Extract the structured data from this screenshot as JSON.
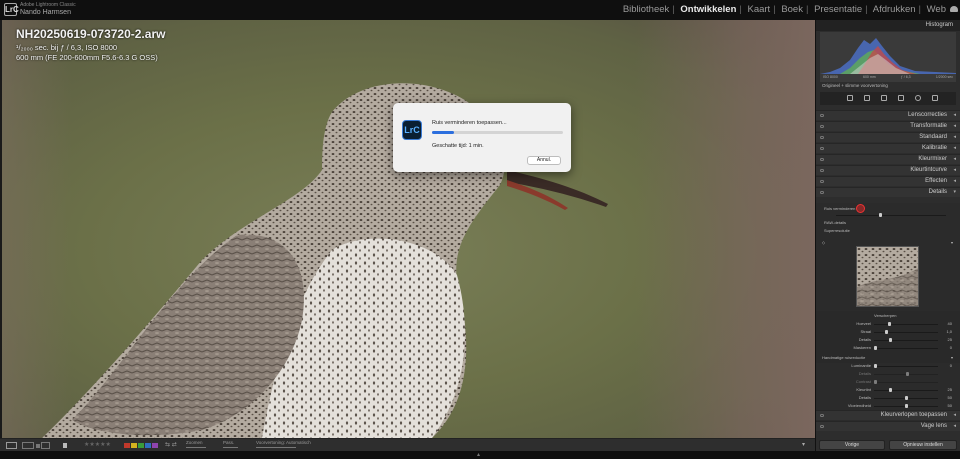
{
  "app": {
    "app_name": "Adobe Lightroom Classic",
    "user_name": "Nando Harmsen",
    "logo_text": "LrC",
    "modules": [
      "Bibliotheek",
      "Ontwikkelen",
      "Kaart",
      "Boek",
      "Presentatie",
      "Afdrukken",
      "Web"
    ],
    "active_module": "Ontwikkelen"
  },
  "photo_info": {
    "file_name": "NH20250619-073720-2.arw",
    "exposure": "¹/₂₀₀₀ sec. bij ƒ / 6,3, ISO 8000",
    "lens": "600 mm (FE 200-600mm F5.6-6.3 G OSS)"
  },
  "dialog": {
    "icon_text": "LrC",
    "progress_label": "Ruis verminderen toepassen...",
    "progress": 0.17,
    "eta_label": "Geschatte tijd: 1 min.",
    "cancel_label": "Annul."
  },
  "toolbar": {
    "stars": "★★★★★",
    "zoom_label": "Zoomen",
    "fit_label": "Pass.",
    "soft_proof_label": "Voorvertoning: Automatisch",
    "label_colors": [
      "#c0392b",
      "#d4b21f",
      "#3a9d3a",
      "#2f6fbf",
      "#8e44ad"
    ]
  },
  "panel": {
    "histogram_title": "Histogram",
    "histogram_meta": [
      "ISO 8000",
      "600 mm",
      "ƒ / 6,3",
      "1/2000 sec"
    ],
    "original_label": "Origineel + slimme voorvertoning",
    "sections": [
      "Lenscorrecties",
      "Transformatie",
      "Standaard",
      "Kalibratie",
      "Kleurmixer",
      "Kleurtintcurve",
      "Effecten",
      "Details"
    ],
    "details": {
      "denoise_label": "Ruis verminderen",
      "raw_details_label": "RAW-details",
      "super_res_label": "Superresolutie",
      "sharpen_title": "Verscherpen",
      "sharpen_sliders": [
        {
          "label": "Hoeveel",
          "value": "40"
        },
        {
          "label": "Straal",
          "value": "1,0"
        },
        {
          "label": "Details",
          "value": "25"
        },
        {
          "label": "Maskeren",
          "value": "0"
        }
      ],
      "manual_nr_title": "Handmatige ruisreductie",
      "manual_sliders": [
        {
          "label": "Luminantie",
          "value": "0"
        },
        {
          "label": "Details",
          "value": ""
        },
        {
          "label": "Contrast",
          "value": ""
        },
        {
          "label": "Kleurtint",
          "value": "25"
        },
        {
          "label": "Details",
          "value": "50"
        },
        {
          "label": "Vloeiendheid",
          "value": "50"
        }
      ]
    },
    "bottom_sections": [
      "Kleurverlopen toepassen",
      "Vage lens"
    ],
    "prev_button": "Vorige",
    "reset_button": "Opnieuw instellen"
  }
}
